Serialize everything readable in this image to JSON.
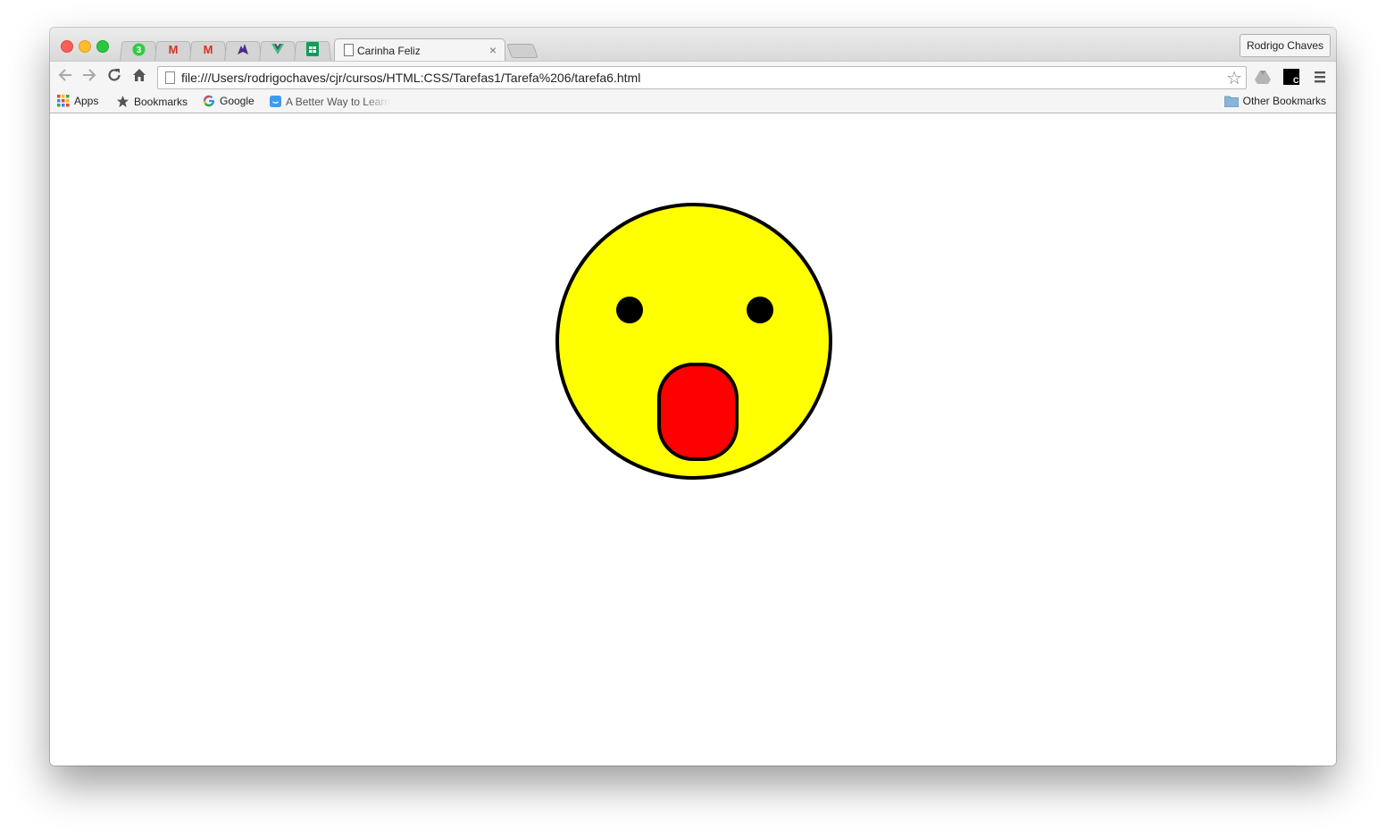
{
  "browser": {
    "profile_name": "Rodrigo Chaves",
    "active_tab": {
      "title": "Carinha Feliz",
      "close_label": "×"
    },
    "pinned_tabs": [
      {
        "icon": "whatsapp-icon",
        "badge": "3",
        "color": "#2ecc40"
      },
      {
        "icon": "gmail-icon",
        "glyph": "M",
        "color": "#d93025"
      },
      {
        "icon": "gmail-icon",
        "glyph": "M",
        "color": "#d93025"
      },
      {
        "icon": "dragon-icon",
        "color": "#4a2a8a"
      },
      {
        "icon": "vue-icon",
        "color": "#41b883"
      },
      {
        "icon": "sheets-icon",
        "color": "#0f9d58"
      }
    ],
    "url": "file:///Users/rodrigochaves/cjr/cursos/HTML:CSS/Tarefas1/Tarefa%206/tarefa6.html",
    "bookmarks": [
      {
        "label": "Apps",
        "icon": "apps-grid-icon"
      },
      {
        "label": "Bookmarks",
        "icon": "star-icon"
      },
      {
        "label": "Google",
        "icon": "google-icon"
      },
      {
        "label": "A Better Way to Learn",
        "icon": "emoji-icon"
      }
    ],
    "other_bookmarks": "Other Bookmarks"
  },
  "page": {
    "face": {
      "face_color": "#ffff00",
      "mouth_color": "#ff0000",
      "outline_color": "#000000",
      "eye_color": "#000000"
    }
  }
}
